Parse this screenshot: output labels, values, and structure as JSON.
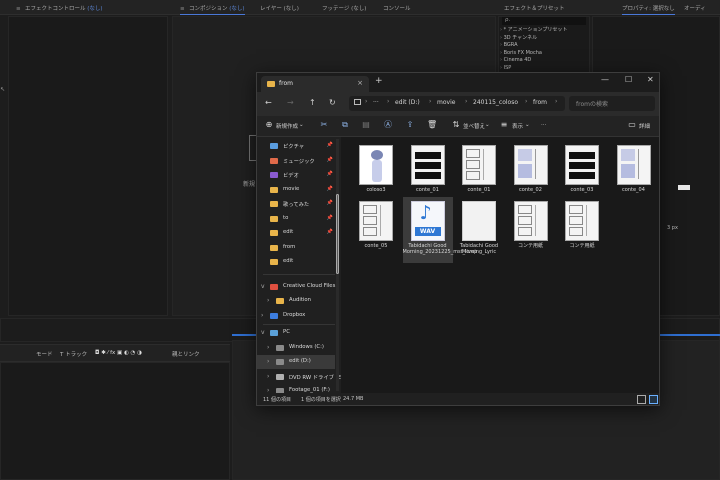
{
  "ae": {
    "panels": {
      "effect_controls": "エフェクトコントロール",
      "effect_controls_sub": "(なし)",
      "composition": "コンポジション",
      "composition_sub": "(なし)",
      "layer": "レイヤー (なし)",
      "footage": "フッテージ (なし)",
      "console": "コンソール",
      "effects_presets": "エフェクト＆プリセット",
      "properties": "プロパティ: 選択なし",
      "audio": "オーディ"
    },
    "search_placeholder": "ρ.",
    "effects_items": [
      "* アニメーションプリセット",
      "3D チャンネル",
      "BGRA",
      "Boris FX Mocha",
      "Cinema 4D",
      "ISP"
    ],
    "viewer_text": "新規",
    "timeline_bar": {
      "mode": "モード",
      "track": "T トラック",
      "parent": "親とリンク"
    },
    "right_partial": "3 px"
  },
  "explorer": {
    "tab_title": "from",
    "new_tab": "+",
    "breadcrumb": [
      "edit (D:)",
      "movie",
      "240115_coloso",
      "from"
    ],
    "search_placeholder": "fromの検索",
    "toolbar": {
      "new": "新規作成",
      "sort": "並べ替え",
      "view": "表示",
      "more": "···",
      "details": "詳細"
    },
    "sidebar": {
      "quick": [
        {
          "label": "ピクチャ",
          "pinned": true,
          "color": "#5a9de0"
        },
        {
          "label": "ミュージック",
          "pinned": true,
          "color": "#e06a4a"
        },
        {
          "label": "ビデオ",
          "pinned": true,
          "color": "#8a5ad0"
        },
        {
          "label": "movie",
          "pinned": true,
          "color": "#e8b44a"
        },
        {
          "label": "歌ってみた",
          "pinned": true,
          "color": "#e8b44a"
        },
        {
          "label": "to",
          "pinned": true,
          "color": "#e8b44a"
        },
        {
          "label": "edit",
          "pinned": true,
          "color": "#e8b44a"
        },
        {
          "label": "from",
          "pinned": false,
          "color": "#e8b44a"
        },
        {
          "label": "edit",
          "pinned": false,
          "color": "#e8b44a"
        }
      ],
      "tree": [
        {
          "label": "Creative Cloud Files",
          "color": "#e05040",
          "expand": "v",
          "indent": 0
        },
        {
          "label": "Audition",
          "color": "#e8b44a",
          "expand": "›",
          "indent": 6
        },
        {
          "label": "Dropbox",
          "color": "#3d7ee0",
          "expand": "›",
          "indent": 0
        },
        {
          "label": "PC",
          "color": "#5aa0d8",
          "expand": "v",
          "indent": 0
        },
        {
          "label": "Windows (C:)",
          "color": "#8a8a8a",
          "expand": "›",
          "indent": 6
        },
        {
          "label": "edit (D:)",
          "color": "#8a8a8a",
          "expand": "›",
          "indent": 6,
          "selected": true
        },
        {
          "label": "DVD RW ドライブ (E:) S",
          "color": "#b0b0b0",
          "expand": "›",
          "indent": 6
        },
        {
          "label": "Footage_01 (F:)",
          "color": "#8a8a8a",
          "expand": "›",
          "indent": 6
        }
      ]
    },
    "files": [
      {
        "name": "coloso3",
        "kind": "figure"
      },
      {
        "name": "conte_01",
        "kind": "bars"
      },
      {
        "name": "conte_01",
        "kind": "sheet"
      },
      {
        "name": "conte_02",
        "kind": "figure-sheet"
      },
      {
        "name": "conte_03",
        "kind": "bars"
      },
      {
        "name": "conte_04",
        "kind": "figure-sheet"
      },
      {
        "name": "conte_05",
        "kind": "sheet"
      },
      {
        "name": "Tabidachi Good Morning_20231225_mst_livep",
        "kind": "wav",
        "selected": true
      },
      {
        "name": "Tabidachi Good Morning_Lyric",
        "kind": "doc"
      },
      {
        "name": "コンテ用紙",
        "kind": "sheet"
      },
      {
        "name": "コンテ用紙",
        "kind": "sheet"
      }
    ],
    "wav_label": "WAV",
    "status": {
      "count": "11 個の項目",
      "selected": "1 個の項目を選択",
      "size": "24.7 MB"
    }
  }
}
